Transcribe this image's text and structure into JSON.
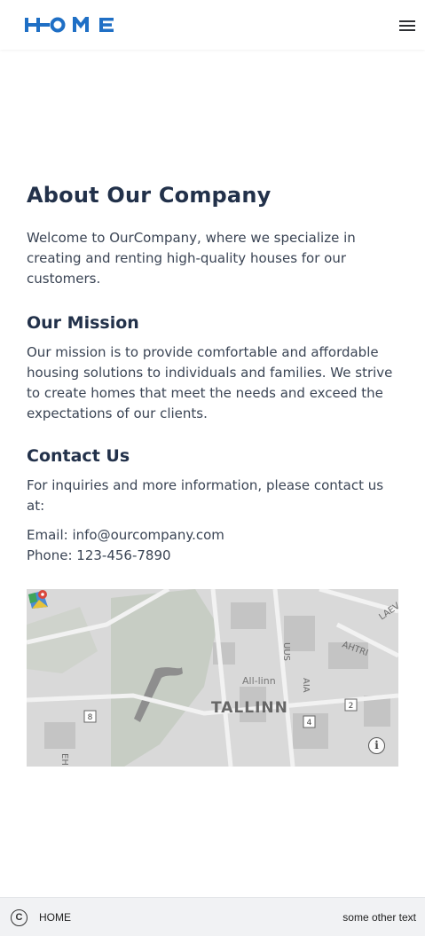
{
  "header": {
    "logo_text": "HOME",
    "logo_icon": "home-logo",
    "menu_icon": "hamburger-menu-icon",
    "brand_color": "#1f6fc5"
  },
  "main": {
    "title": "About Our Company",
    "intro": "Welcome to OurCompany, where we specialize in creating and renting high-quality houses for our customers.",
    "mission": {
      "title": "Our Mission",
      "text": "Our mission is to provide comfortable and affordable housing solutions to individuals and families. We strive to create homes that meet the needs and exceed the expectations of our clients."
    },
    "contact": {
      "title": "Contact Us",
      "text": "For inquiries and more information, please contact us at:",
      "email": "Email: info@ourcompany.com",
      "phone": "Phone: 123-456-7890"
    }
  },
  "map": {
    "city_label": "TALLINN",
    "district_label": "All-linn",
    "street_labels": [
      "UUS",
      "AIA",
      "AHTRI",
      "LAEV",
      "EH"
    ],
    "road_markers": [
      "8",
      "4",
      "2"
    ],
    "info_icon": "info-icon",
    "maps_logo": "google-maps-logo"
  },
  "footer": {
    "copyright_icon": "copyright-icon",
    "copyright_symbol": "C",
    "home_label": "HOME",
    "other_text": "some other text"
  }
}
